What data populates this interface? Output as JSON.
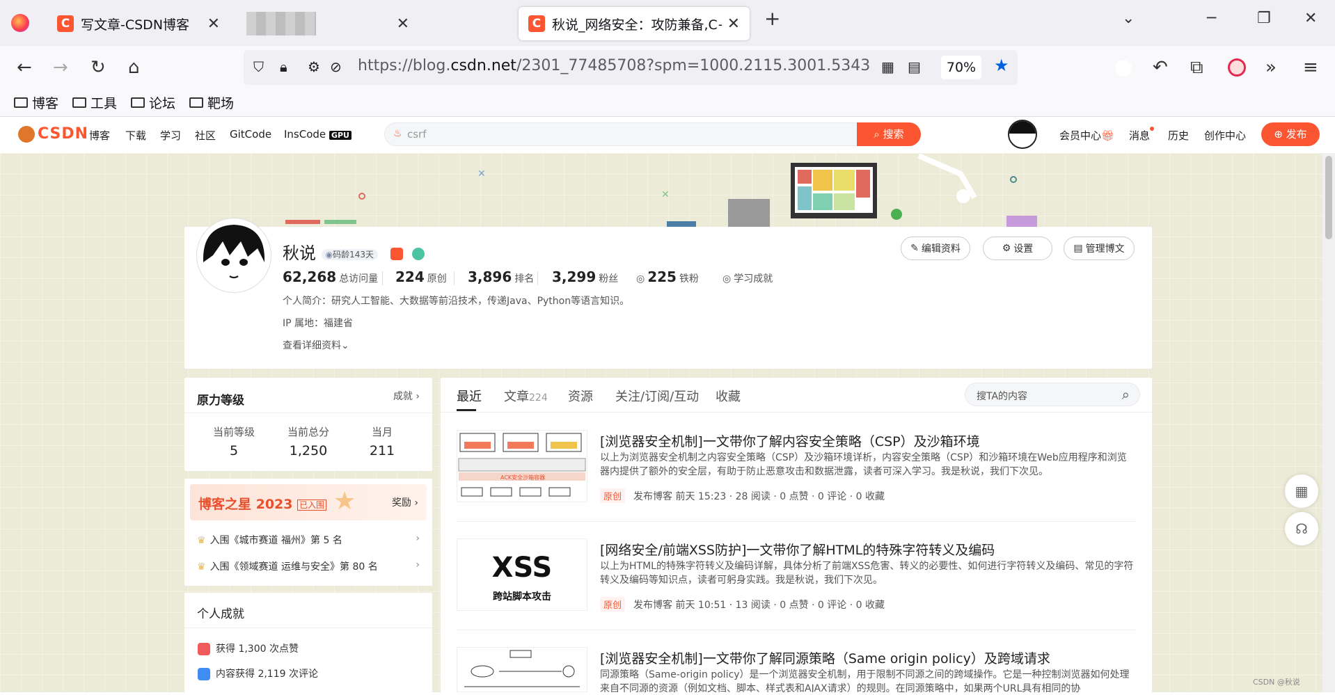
{
  "browser": {
    "tabs": [
      {
        "title": "写文章-CSDN博客"
      },
      {
        "title": ""
      },
      {
        "title": "秋说_网络安全：攻防兼备,C++-"
      }
    ],
    "url_prefix": "https://blog.",
    "url_domain": "csdn.net",
    "url_rest": "/2301_77485708?spm=1000.2115.3001.5343",
    "zoom": "70%",
    "bookmarks": [
      "博客",
      "工具",
      "论坛",
      "靶场"
    ]
  },
  "csdn_nav": {
    "logo": "CSDN",
    "links": [
      "博客",
      "下载",
      "学习",
      "社区",
      "GitCode",
      "InsCode"
    ],
    "gpu_badge": "GPU",
    "search_placeholder": "csrf",
    "search_button": "搜索",
    "right_links": [
      "会员中心",
      "消息",
      "历史",
      "创作中心"
    ],
    "publish": "发布"
  },
  "profile": {
    "name": "秋说",
    "code_age": "码龄143天",
    "stats": [
      {
        "value": "62,268",
        "label": "总访问量"
      },
      {
        "value": "224",
        "label": "原创"
      },
      {
        "value": "3,896",
        "label": "排名"
      },
      {
        "value": "3,299",
        "label": "粉丝"
      },
      {
        "value": "225",
        "label": "铁粉"
      }
    ],
    "learning": "学习成就",
    "bio": "个人简介：研究人工智能、大数据等前沿技术，传递Java、Python等语言知识。",
    "ip": "IP 属地：福建省",
    "more": "查看详细资料",
    "buttons": [
      "编辑资料",
      "设置",
      "管理博文"
    ]
  },
  "level": {
    "title": "原力等级",
    "link": "成就",
    "items": [
      {
        "label": "当前等级",
        "value": "5"
      },
      {
        "label": "当前总分",
        "value": "1,250"
      },
      {
        "label": "当月",
        "value": "211"
      }
    ]
  },
  "star": {
    "title": "博客之星 2023",
    "badge": "已入围",
    "link": "奖励",
    "items": [
      "入围《城市赛道 福州》第 5 名",
      "入围《领域赛道 运维与安全》第 80 名"
    ]
  },
  "achievements": {
    "title": "个人成就",
    "items": [
      "获得 1,300 次点赞",
      "内容获得 2,119 次评论"
    ]
  },
  "content_tabs": {
    "items": [
      "最近",
      "文章",
      "资源",
      "关注/订阅/互动",
      "收藏"
    ],
    "article_count": "224",
    "search_placeholder": "搜TA的内容"
  },
  "articles": [
    {
      "title": "[浏览器安全机制]一文带你了解内容安全策略（CSP）及沙箱环境",
      "desc": "以上为浏览器安全机制之内容安全策略（CSP）及沙箱环境详析，内容安全策略（CSP）和沙箱环境在Web应用程序和浏览器内提供了额外的安全层，有助于防止恶意攻击和数据泄露，读者可深入学习。我是秋说，我们下次见。",
      "tag": "原创",
      "meta": "发布博客 前天 15:23 · 28 阅读 · 0 点赞 · 0 评论 · 0 收藏",
      "thumb_text": "ACK安全沙箱容器"
    },
    {
      "title": "[网络安全/前端XSS防护]一文带你了解HTML的特殊字符转义及编码",
      "desc": "以上为HTML的特殊字符转义及编码详解，具体分析了前端XSS危害、转义的必要性、如何进行字符转义及编码、常见的字符转义及编码等知识点，读者可躬身实践。我是秋说，我们下次见。",
      "tag": "原创",
      "meta": "发布博客 前天 10:51 · 13 阅读 · 0 点赞 · 0 评论 · 0 收藏",
      "thumb_big": "XSS",
      "thumb_sub": "跨站脚本攻击"
    },
    {
      "title": "[浏览器安全机制]一文带你了解同源策略（Same origin policy）及跨域请求",
      "desc": "同源策略（Same-origin policy）是一个浏览器安全机制，用于限制不同源之间的跨域操作。它是一种控制浏览器如何处理来自不同源的资源（例如文档、脚本、样式表和AJAX请求）的规则。在同源策略中，如果两个URL具有相同的协"
    }
  ],
  "watermark": "CSDN @秋说"
}
